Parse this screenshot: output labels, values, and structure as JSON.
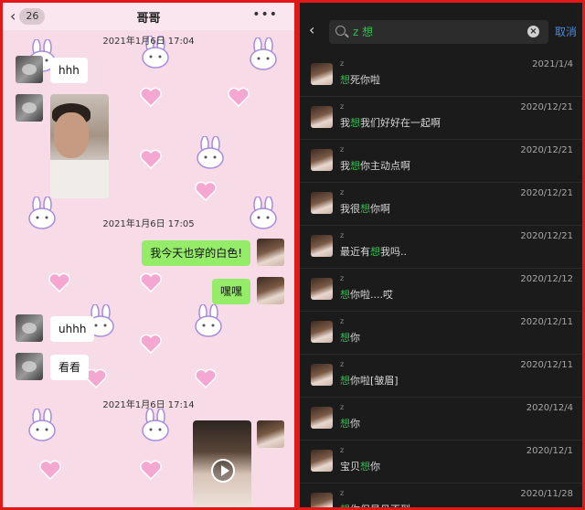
{
  "chat": {
    "unread_count": "26",
    "title": "哥哥",
    "more_label": "•••",
    "timestamps": [
      "2021年1月6日 17:04",
      "2021年1月6日 17:05",
      "2021年1月6日 17:14"
    ],
    "messages": [
      {
        "side": "in",
        "text": "hhh"
      },
      {
        "side": "in",
        "type": "photo"
      },
      {
        "side": "out",
        "text": "我今天也穿的白色!"
      },
      {
        "side": "out",
        "text": "嘿嘿"
      },
      {
        "side": "in",
        "text": "uhhh"
      },
      {
        "side": "in",
        "text": "看看"
      },
      {
        "side": "in",
        "type": "video"
      }
    ]
  },
  "search": {
    "query": "z 想",
    "cancel_label": "取消",
    "results": [
      {
        "name": "z",
        "pre": "",
        "hl": "想",
        "post": "死你啦",
        "date": "2021/1/4"
      },
      {
        "name": "z",
        "pre": "我",
        "hl": "想",
        "post": "我们好好在一起啊",
        "date": "2020/12/21"
      },
      {
        "name": "z",
        "pre": "我",
        "hl": "想",
        "post": "你主动点啊",
        "date": "2020/12/21"
      },
      {
        "name": "z",
        "pre": "我很",
        "hl": "想",
        "post": "你啊",
        "date": "2020/12/21"
      },
      {
        "name": "z",
        "pre": "最近有",
        "hl": "想",
        "post": "我吗..",
        "date": "2020/12/21"
      },
      {
        "name": "z",
        "pre": "",
        "hl": "想",
        "post": "你啦....哎",
        "date": "2020/12/12"
      },
      {
        "name": "z",
        "pre": "",
        "hl": "想",
        "post": "你",
        "date": "2020/12/11"
      },
      {
        "name": "z",
        "pre": "",
        "hl": "想",
        "post": "你啦[皱眉]",
        "date": "2020/12/11"
      },
      {
        "name": "z",
        "pre": "",
        "hl": "想",
        "post": "你",
        "date": "2020/12/4"
      },
      {
        "name": "z",
        "pre": "宝贝",
        "hl": "想",
        "post": "你",
        "date": "2020/12/1"
      },
      {
        "name": "z",
        "pre": "",
        "hl": "想",
        "post": "你但是见不到",
        "date": "2020/11/28"
      }
    ]
  },
  "colors": {
    "highlight": "#2fbf4f",
    "frame": "#e01818",
    "out_bubble": "#95ec69",
    "chat_bg": "#f7dbe6"
  }
}
